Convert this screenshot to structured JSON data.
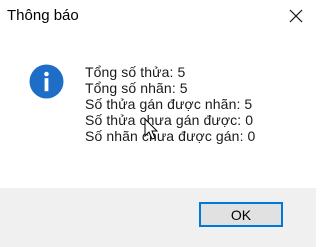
{
  "window": {
    "title": "Thông báo",
    "close_icon": "close-icon"
  },
  "message": {
    "icon": "info-icon",
    "lines": [
      "Tổng số thửa: 5",
      "Tổng số nhãn: 5",
      "Số thửa gán được nhãn: 5",
      "Số thửa chưa gán được: 0",
      "Số nhãn chưa được gán: 0"
    ]
  },
  "buttons": {
    "ok_label": "OK"
  },
  "colors": {
    "info_blue": "#1e6ec8",
    "focus_border": "#0078d7",
    "footer_bg": "#f0f0f0"
  }
}
